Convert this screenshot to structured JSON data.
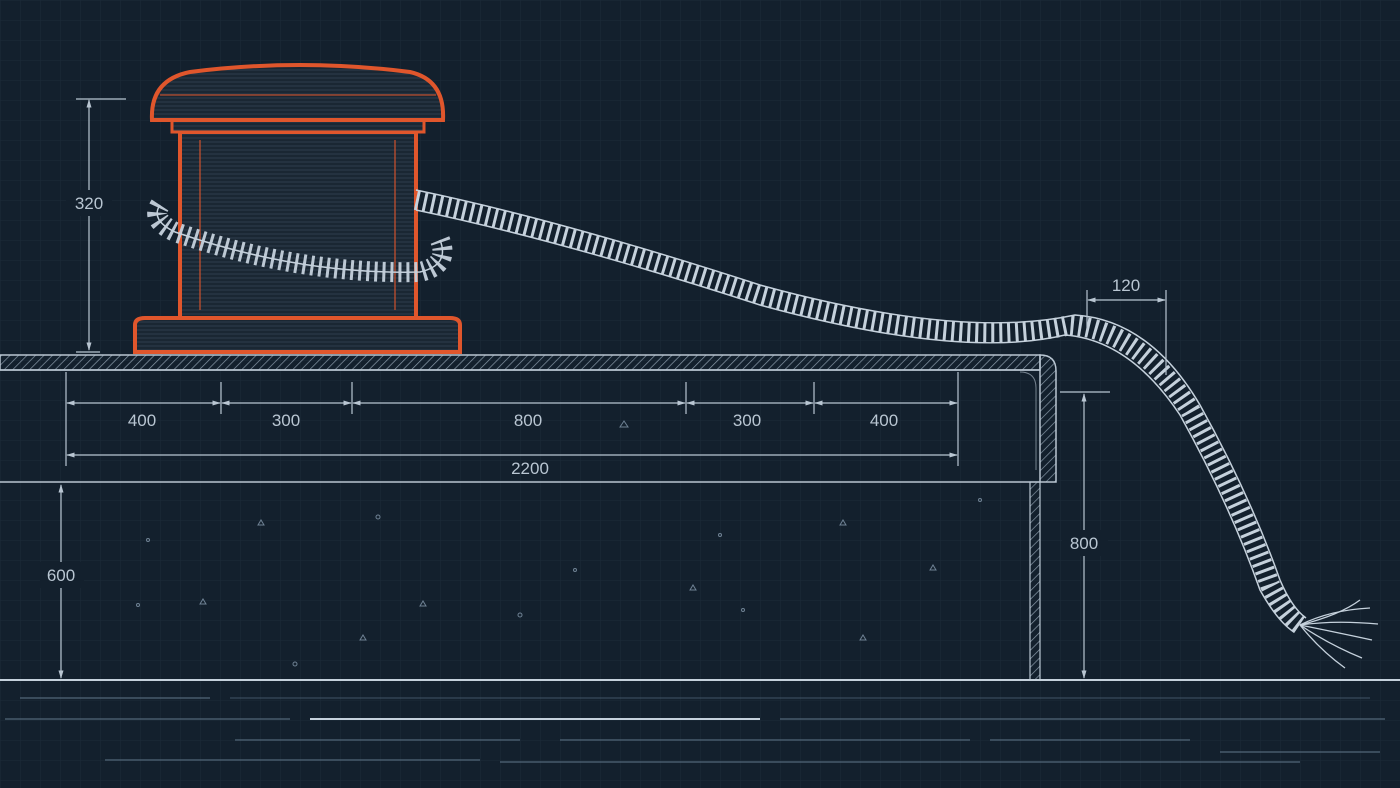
{
  "colors": {
    "background": "#13202d",
    "grid": "#1c2b39",
    "line": "#b9c6d2",
    "bollard": "#e0562c",
    "rope": "#c5d1dc"
  },
  "dimensions": {
    "bollard_height": "320",
    "rope_sag": "120",
    "seg_1": "400",
    "seg_2": "300",
    "seg_3": "800",
    "seg_4": "300",
    "seg_5": "400",
    "total_width": "2200",
    "pier_height": "600",
    "edge_height": "800"
  }
}
